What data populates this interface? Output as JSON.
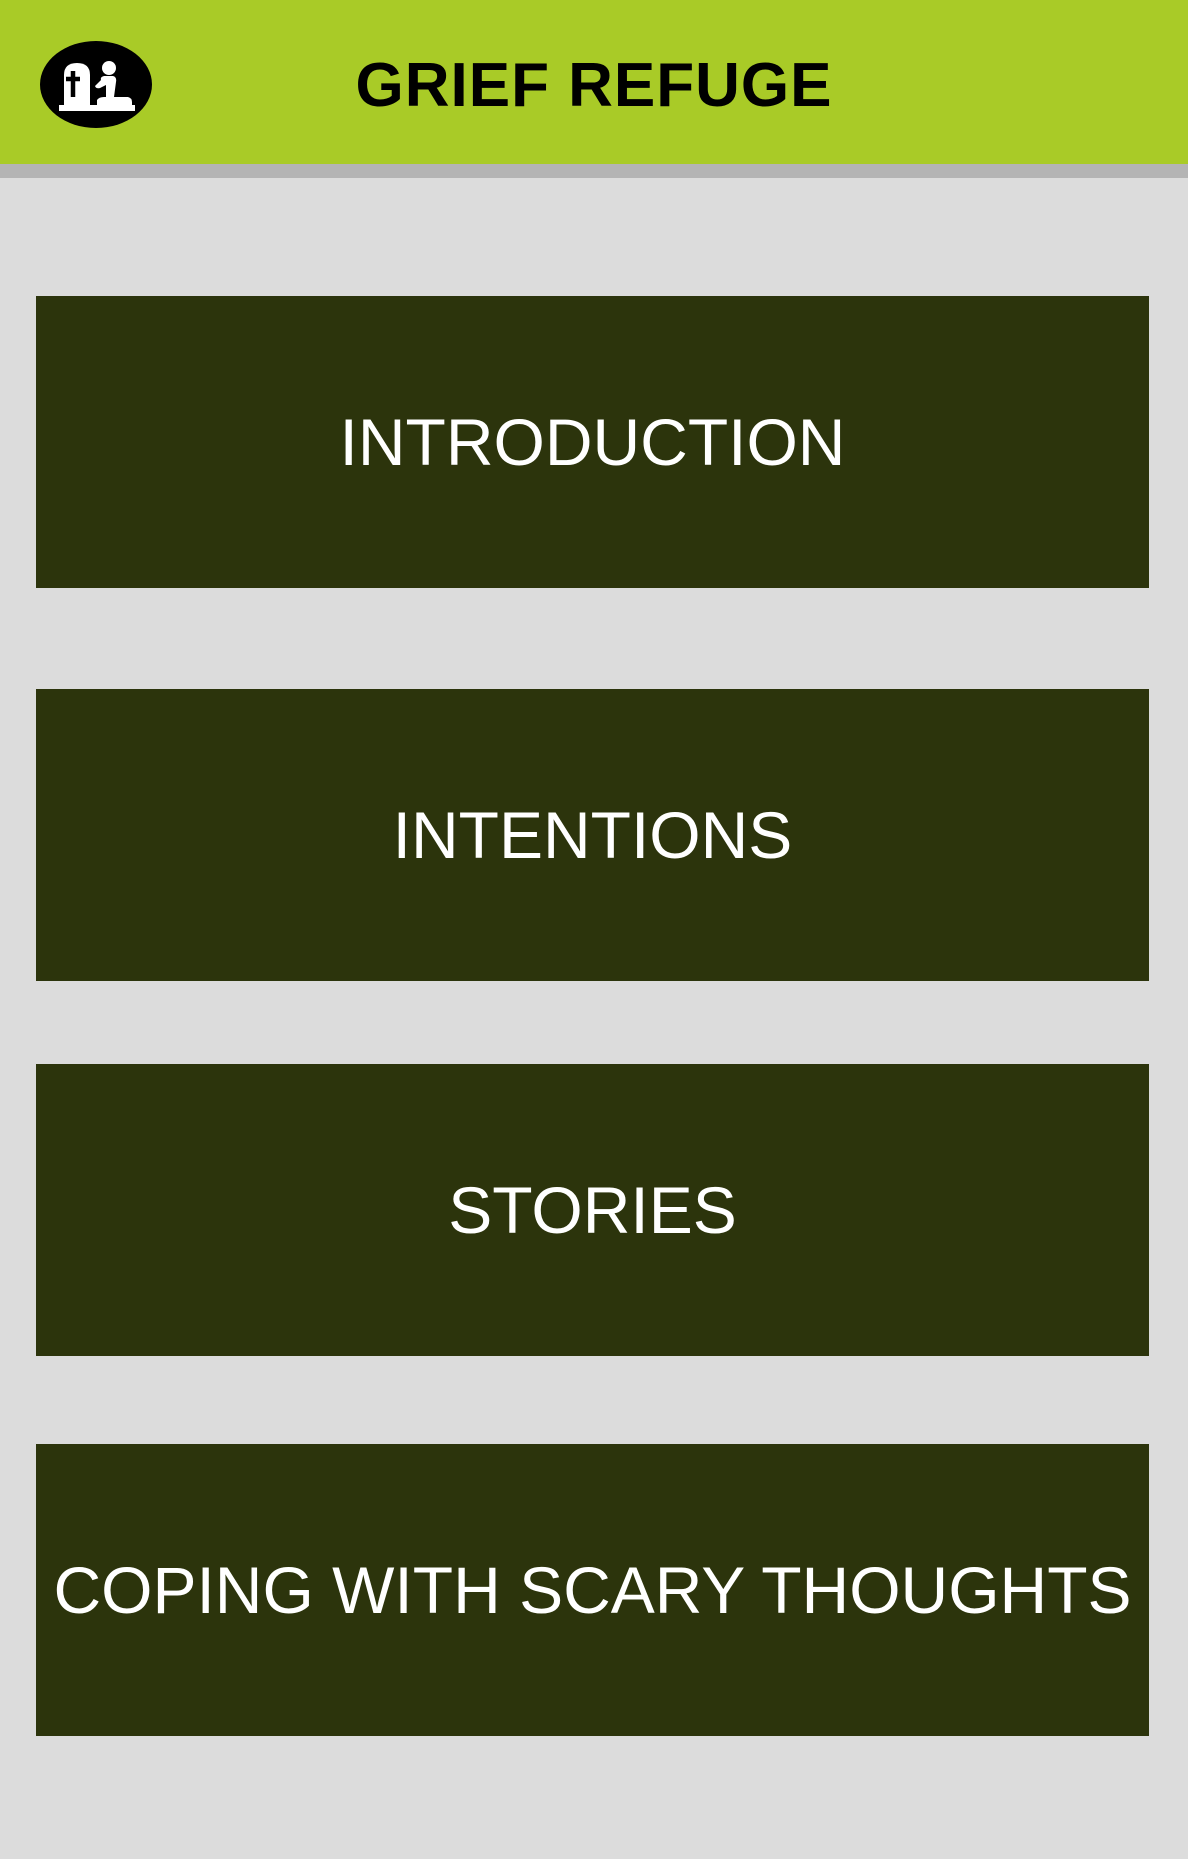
{
  "app_bar": {
    "title": "GRIEF REFUGE",
    "logo_icon": "mourner-at-grave-icon",
    "background_color": "#a9cb27"
  },
  "menu": {
    "background_color": "#2c340c",
    "text_color": "#ffffff",
    "items": [
      {
        "label": "INTRODUCTION"
      },
      {
        "label": "INTENTIONS"
      },
      {
        "label": "STORIES"
      },
      {
        "label": "COPING WITH SCARY THOUGHTS"
      }
    ]
  }
}
